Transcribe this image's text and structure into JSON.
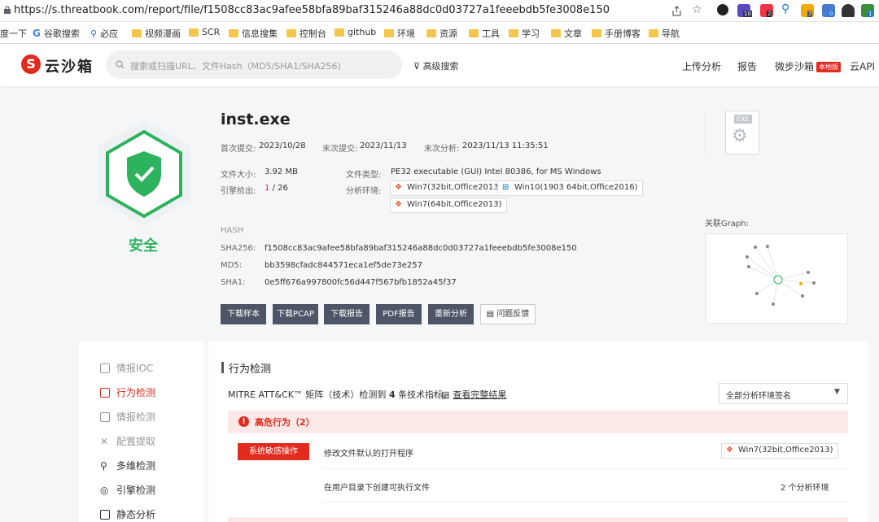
{
  "browser": {
    "url": "https://s.threatbook.com/report/file/f1508cc83ac9afee58bfa89baf315246a88dc0d03727a1feeebdb5fe3008e150",
    "bookmarks": [
      "度一下",
      "谷歌搜索",
      "必应",
      "视频漫画",
      "SCR",
      "信息搜集",
      "控制台",
      "github",
      "环境",
      "资源",
      "工具",
      "学习",
      "文章",
      "手册博客",
      "导航"
    ],
    "ext_counts": [
      "10",
      "2",
      "7",
      "0",
      "1"
    ]
  },
  "header": {
    "logo": "云沙箱",
    "search_placeholder": "搜索或扫描URL、文件Hash（MD5/SHA1/SHA256)",
    "advanced_search": "高级搜索",
    "nav": [
      "上传分析",
      "报告",
      "微步沙箱",
      "云API"
    ],
    "local_badge": "本地版"
  },
  "file": {
    "verdict": "安全",
    "name": "inst.exe",
    "first_submit_label": "首次提交:",
    "first_submit": "2023/10/28",
    "last_submit_label": "末次提交:",
    "last_submit": "2023/11/13",
    "last_analysis_label": "末次分析:",
    "last_analysis": "2023/11/13 11:35:51",
    "size_label": "文件大小:",
    "size": "3.92 MB",
    "engine_label": "引擎检出:",
    "engine_hits": "1",
    "engine_total": "/ 26",
    "type_label": "文件类型:",
    "type": "PE32 executable (GUI) Intel 80386, for MS Windows",
    "env_label": "分析环境:",
    "envs": [
      "Win7(32bit,Office2013)",
      "Win10(1903 64bit,Office2016)",
      "Win7(64bit,Office2013)"
    ],
    "hash_title": "HASH",
    "sha256_label": "SHA256:",
    "sha256": "f1508cc83ac9afee58bfa89baf315246a88dc0d03727a1feeebdb5fe3008e150",
    "md5_label": "MD5:",
    "md5": "bb3598cfadc844571eca1ef5de73e257",
    "sha1_label": "SHA1:",
    "sha1": "0e5ff676a997800fc56d447f567bfb1852a45f37",
    "exe_icon_label": "EXE",
    "graph_label": "关联Graph:"
  },
  "actions": [
    "下载样本",
    "下载PCAP",
    "下载报告",
    "PDF报告",
    "重新分析",
    "问题反馈"
  ],
  "sidenav": [
    "情报IOC",
    "行为检测",
    "情报检测",
    "配置提取",
    "多维检测",
    "引擎检测",
    "静态分析"
  ],
  "behavior": {
    "title": "行为检测",
    "summary_prefix": "MITRE ATT&CK™ 矩阵（技术）检测到",
    "summary_count": "4",
    "summary_suffix": "条技术指标。",
    "full_result": "查看完整结果",
    "env_select": "全部分析环境签名",
    "danger_title": "高危行为（2）",
    "tag": "系统敏感操作",
    "rows": [
      {
        "desc": "修改文件默认的打开程序",
        "env": "Win7(32bit,Office2013)"
      },
      {
        "desc": "在用户目录下创建可执行文件",
        "env": "2 个分析环境"
      }
    ]
  },
  "colors": {
    "accent": "#e32a1f",
    "safe": "#2db35d",
    "btn": "#4e5566"
  }
}
